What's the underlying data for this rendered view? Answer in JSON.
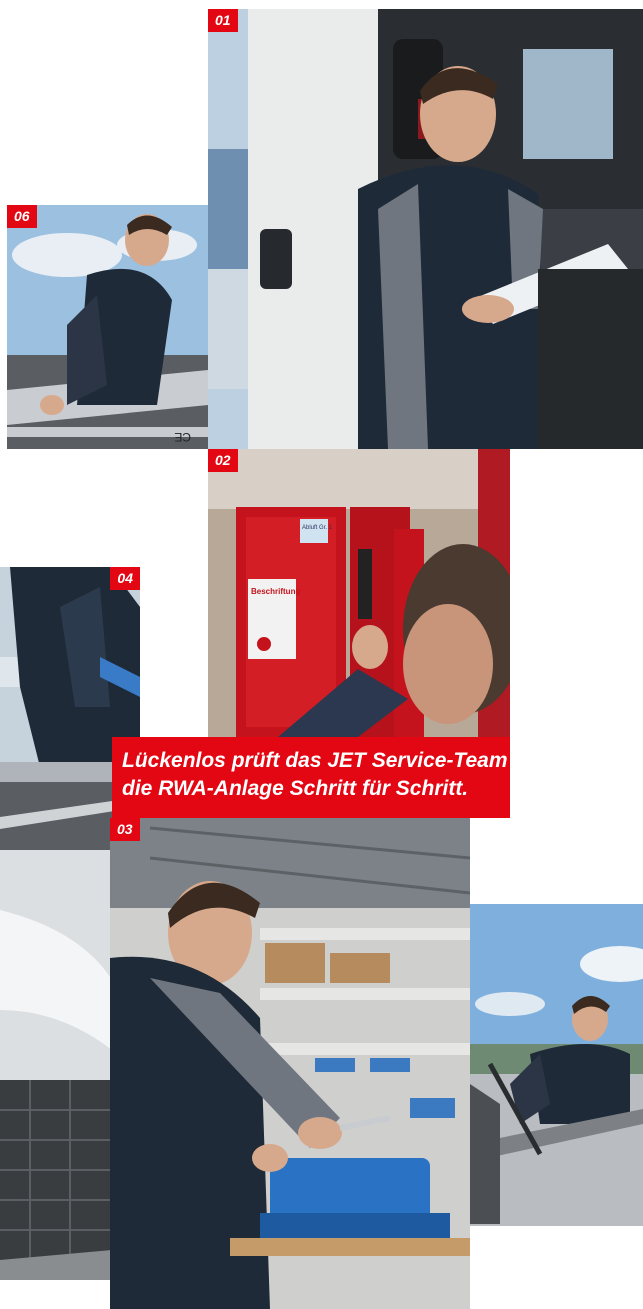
{
  "photos": {
    "p01": {
      "label": "01",
      "description_icon": "technician-van-clipboard"
    },
    "p06": {
      "label": "06",
      "description_icon": "technician-roof-ladder"
    },
    "p02": {
      "label": "02",
      "description_icon": "technician-red-control-cabinet"
    },
    "p04": {
      "label": "04",
      "description_icon": "technician-roof-harness"
    },
    "p03": {
      "label": "03",
      "description_icon": "technician-bench-vise"
    },
    "p05": {
      "label": "",
      "description_icon": "technician-roof-frame"
    },
    "p_left_bottom": {
      "label": "",
      "description_icon": "smoke-vent-closeup"
    }
  },
  "caption": {
    "line1": "Lückenlos prüft das JET Service-Team",
    "line2": "die RWA-Anlage Schritt für Schritt."
  },
  "cabinet_sign": {
    "title": "Beschriftung",
    "small_label": "Abluft Gr. 1"
  },
  "colors": {
    "accent": "#e30613",
    "jacket_dark": "#1f2a38",
    "jacket_gray": "#6f7680",
    "sky": "#8fb6dc",
    "vise_blue": "#2a72c4"
  }
}
